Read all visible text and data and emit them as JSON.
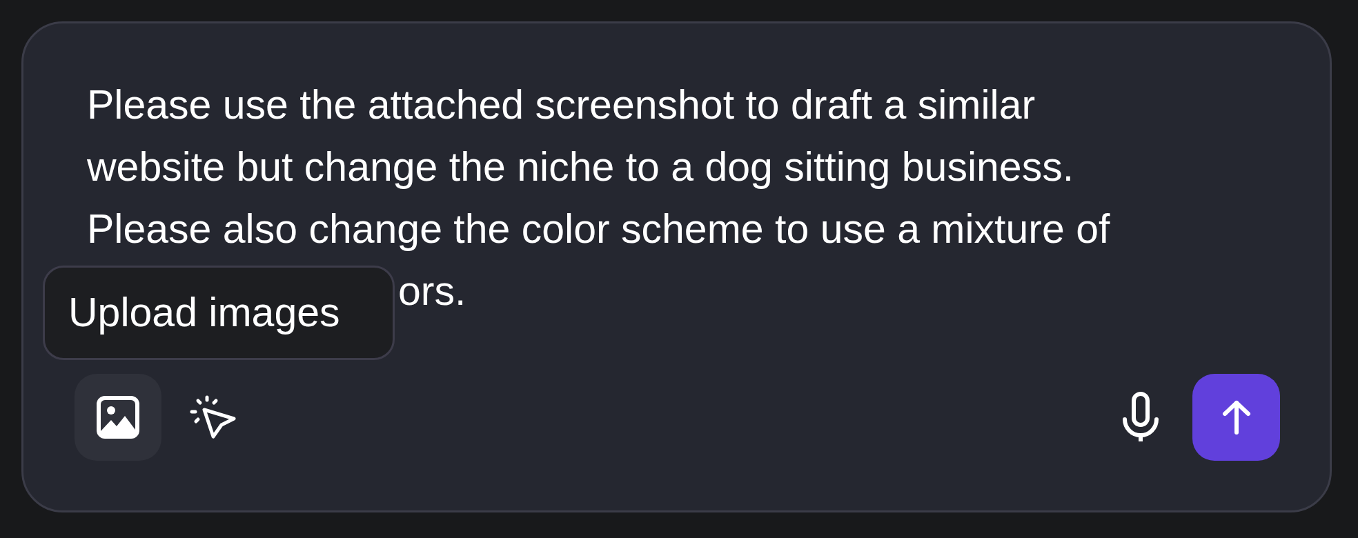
{
  "message": {
    "text": "Please use the attached screenshot to draft a similar\nwebsite but change the niche to a dog sitting business.\nPlease also change the color scheme to use a mixture of",
    "tail": "ors."
  },
  "tooltip": {
    "text": "Upload images"
  }
}
